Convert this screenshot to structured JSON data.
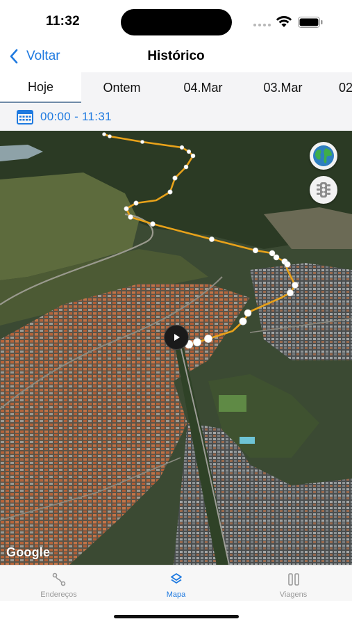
{
  "status_bar": {
    "time": "11:32",
    "icons": [
      "wifi-icon",
      "battery-icon"
    ]
  },
  "nav": {
    "back_label": "Voltar",
    "title": "Histórico"
  },
  "date_tabs": [
    {
      "label": "Hoje",
      "active": true
    },
    {
      "label": "Ontem",
      "active": false
    },
    {
      "label": "04.Mar",
      "active": false
    },
    {
      "label": "03.Mar",
      "active": false
    },
    {
      "label": "02",
      "active": false
    }
  ],
  "time_filter": {
    "range": "00:00 - 11:31",
    "icon": "calendar-icon"
  },
  "map": {
    "attribution": "Google",
    "controls": [
      "globe-icon",
      "traffic-light-icon"
    ],
    "route_color": "#e8a21a"
  },
  "tab_bar": [
    {
      "label": "Endereços",
      "icon": "route-icon",
      "active": false
    },
    {
      "label": "Mapa",
      "icon": "layers-icon",
      "active": true
    },
    {
      "label": "Viagens",
      "icon": "columns-icon",
      "active": false
    }
  ],
  "colors": {
    "accent": "#1f7ae0",
    "tab_inactive": "#9a9a9a"
  }
}
